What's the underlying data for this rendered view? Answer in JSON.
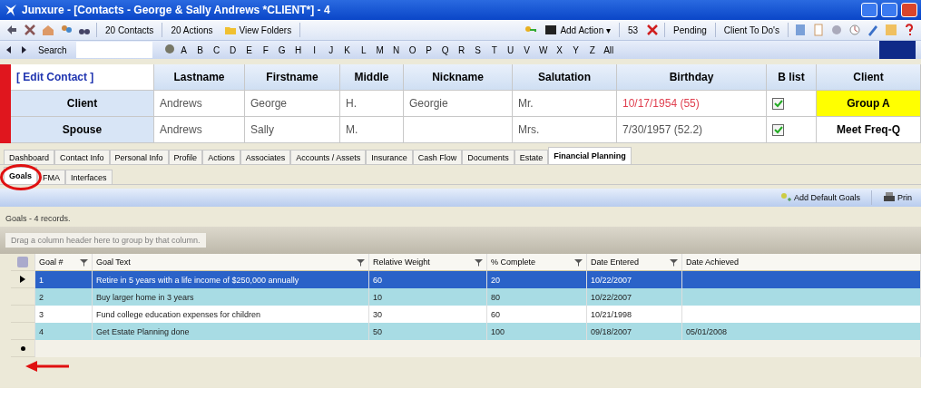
{
  "window": {
    "title": "Junxure - [Contacts - George & Sally Andrews *CLIENT*] - 4"
  },
  "toolbar": {
    "left": [
      "20 Contacts",
      "20 Actions",
      "View Folders"
    ],
    "add_action": "Add Action",
    "add_action_caret": "▾",
    "count": "53",
    "right": [
      "Pending",
      "Client To Do's"
    ]
  },
  "search": {
    "label": "Search"
  },
  "alphabet": [
    "A",
    "B",
    "C",
    "D",
    "E",
    "F",
    "G",
    "H",
    "I",
    "J",
    "K",
    "L",
    "M",
    "N",
    "O",
    "P",
    "Q",
    "R",
    "S",
    "T",
    "U",
    "V",
    "W",
    "X",
    "Y",
    "Z",
    "All"
  ],
  "contact": {
    "edit_link": "[ Edit Contact ]",
    "columns": [
      "Lastname",
      "Firstname",
      "Middle",
      "Nickname",
      "Salutation",
      "Birthday",
      "B list",
      "Client"
    ],
    "rows": [
      {
        "role": "Client",
        "cells": [
          "Andrews",
          "George",
          "H.",
          "Georgie",
          "Mr."
        ],
        "birthday": "10/17/1954 (55)",
        "birthday_alert": true,
        "b_list": true,
        "client": "Group A",
        "client_highlight": true
      },
      {
        "role": "Spouse",
        "cells": [
          "Andrews",
          "Sally",
          "M.",
          "",
          "Mrs."
        ],
        "birthday": "7/30/1957 (52.2)",
        "birthday_alert": false,
        "b_list": true,
        "client": "Meet Freq-Q",
        "client_highlight": false
      }
    ]
  },
  "tabs": [
    {
      "label": "Dashboard",
      "selected": false
    },
    {
      "label": "Contact Info",
      "selected": false
    },
    {
      "label": "Personal Info",
      "selected": false
    },
    {
      "label": "Profile",
      "selected": false
    },
    {
      "label": "Actions",
      "selected": false
    },
    {
      "label": "Associates",
      "selected": false
    },
    {
      "label": "Accounts / Assets",
      "selected": false
    },
    {
      "label": "Insurance",
      "selected": false
    },
    {
      "label": "Cash Flow",
      "selected": false
    },
    {
      "label": "Documents",
      "selected": false
    },
    {
      "label": "Estate",
      "selected": false
    },
    {
      "label": "Financial Planning",
      "selected": true
    }
  ],
  "subtabs": [
    {
      "label": "Goals",
      "selected": true
    },
    {
      "label": "FMA",
      "selected": false
    },
    {
      "label": "Interfaces",
      "selected": false
    }
  ],
  "actions": [
    "Add Default Goals",
    "Prin"
  ],
  "record_count": "Goals - 4 records.",
  "group_hint": "Drag a column header here to group by that column.",
  "grid": {
    "columns": [
      "Goal #",
      "Goal Text",
      "Relative Weight",
      "% Complete",
      "Date Entered",
      "Date Achieved"
    ],
    "rows": [
      {
        "cells": [
          "1",
          "Retire in 5 years with a life income of $250,000 annually",
          "60",
          "20",
          "10/22/2007",
          ""
        ],
        "selected": true
      },
      {
        "cells": [
          "2",
          "Buy larger home in 3 years",
          "10",
          "80",
          "10/22/2007",
          ""
        ],
        "selected": false
      },
      {
        "cells": [
          "3",
          "Fund college education expenses for children",
          "30",
          "60",
          "10/21/1998",
          ""
        ],
        "selected": false
      },
      {
        "cells": [
          "4",
          "Get Estate Planning done",
          "50",
          "100",
          "09/18/2007",
          "05/01/2008"
        ],
        "selected": false
      }
    ]
  }
}
